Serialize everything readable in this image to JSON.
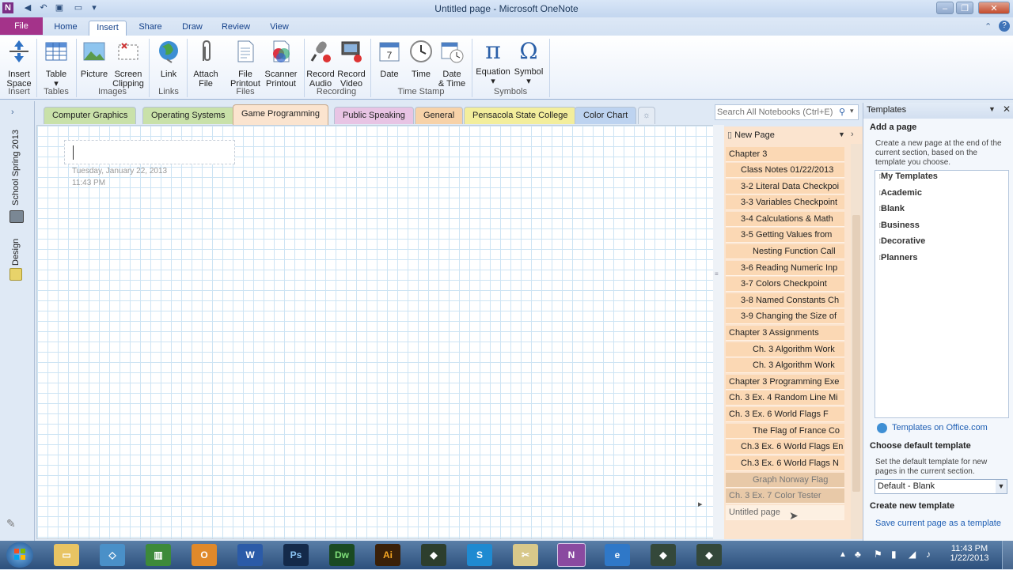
{
  "window": {
    "title": "Untitled page - Microsoft OneNote"
  },
  "ribbon_tabs": [
    "File",
    "Home",
    "Insert",
    "Share",
    "Draw",
    "Review",
    "View"
  ],
  "ribbon": {
    "buttons": [
      {
        "label1": "Insert",
        "label2": "Space"
      },
      {
        "label1": "Table",
        "label2": ""
      },
      {
        "label1": "Picture",
        "label2": ""
      },
      {
        "label1": "Screen",
        "label2": "Clipping"
      },
      {
        "label1": "Link",
        "label2": ""
      },
      {
        "label1": "Attach",
        "label2": "File"
      },
      {
        "label1": "File",
        "label2": "Printout"
      },
      {
        "label1": "Scanner",
        "label2": "Printout"
      },
      {
        "label1": "Record",
        "label2": "Audio"
      },
      {
        "label1": "Record",
        "label2": "Video"
      },
      {
        "label1": "Date",
        "label2": ""
      },
      {
        "label1": "Time",
        "label2": ""
      },
      {
        "label1": "Date",
        "label2": "& Time"
      },
      {
        "label1": "Equation",
        "label2": ""
      },
      {
        "label1": "Symbol",
        "label2": ""
      }
    ],
    "groups": [
      "Insert",
      "Tables",
      "Images",
      "Links",
      "Files",
      "Recording",
      "Time Stamp",
      "Symbols"
    ]
  },
  "notebooks": [
    "School Spring 2013",
    "Design"
  ],
  "section_tabs": [
    "Computer Graphics",
    "Operating Systems",
    "Game Programming",
    "Public Speaking",
    "General",
    "Pensacola State College",
    "Color Chart"
  ],
  "page": {
    "date": "Tuesday, January 22, 2013",
    "time": "11:43 PM"
  },
  "search": {
    "placeholder": "Search All Notebooks (Ctrl+E)"
  },
  "pagelist": {
    "new_page": "New Page",
    "items": [
      "Chapter 3",
      "Class Notes 01/22/2013",
      "3-2 Literal Data Checkpoi",
      "3-3 Variables Checkpoint",
      "3-4 Calculations & Math",
      "3-5 Getting Values from",
      "Nesting Function Call",
      "3-6 Reading Numeric Inp",
      "3-7 Colors Checkpoint",
      "3-8 Named Constants Ch",
      "3-9 Changing the Size of",
      "Chapter 3 Assignments",
      "Ch. 3 Algorithm Work",
      "Ch. 3 Algorithm Work",
      "Chapter 3 Programming Exe",
      "Ch. 3 Ex. 4 Random Line Mi",
      "Ch. 3 Ex. 6 World Flags F",
      "The Flag of France Co",
      "Ch.3 Ex. 6 World Flags En",
      "Ch.3 Ex. 6 World Flags N",
      "Graph Norway Flag",
      "Ch. 3 Ex. 7 Color Tester",
      "Untitled page"
    ]
  },
  "templates": {
    "title": "Templates",
    "add_page_heading": "Add a page",
    "add_page_text": "Create a new page at the end of the current section, based on the template you choose.",
    "categories": [
      "My Templates",
      "Academic",
      "Blank",
      "Business",
      "Decorative",
      "Planners"
    ],
    "office_link": "Templates on Office.com",
    "default_heading": "Choose default template",
    "default_text": "Set the default template for new pages in the current section.",
    "default_value": "Default - Blank",
    "create_heading": "Create new template",
    "save_link": "Save current page as a template"
  },
  "taskbar": {
    "time": "11:43 PM",
    "date": "1/22/2013"
  }
}
